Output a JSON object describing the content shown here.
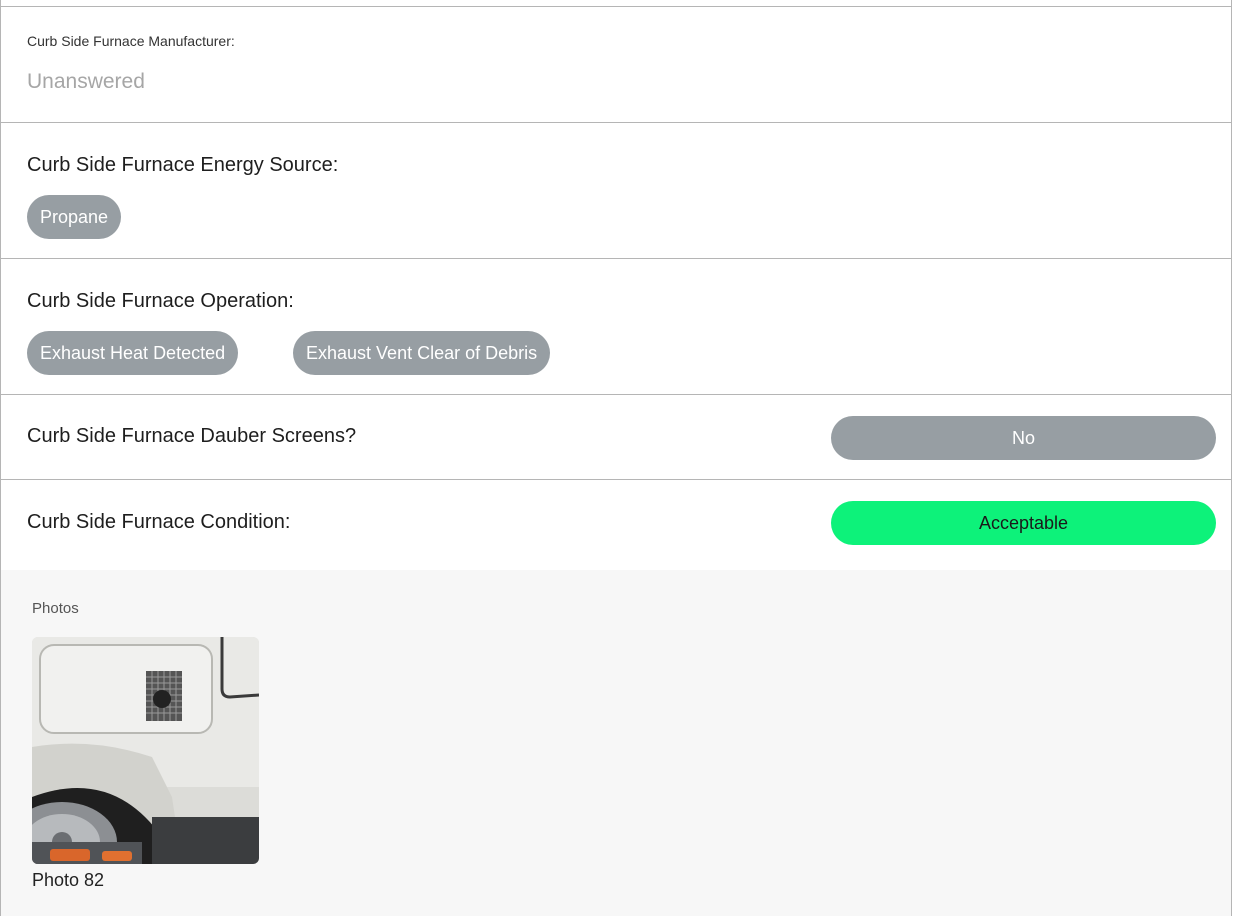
{
  "manufacturer": {
    "label": "Curb Side Furnace Manufacturer:",
    "value": "Unanswered"
  },
  "energy_source": {
    "label": "Curb Side Furnace Energy Source:",
    "options": [
      "Propane"
    ]
  },
  "operation": {
    "label": "Curb Side Furnace Operation:",
    "options": [
      "Exhaust Heat Detected",
      "Exhaust Vent Clear of Debris"
    ]
  },
  "dauber_screens": {
    "label": "Curb Side Furnace Dauber Screens?",
    "value": "No",
    "color": "#979ea3"
  },
  "condition": {
    "label": "Curb Side Furnace Condition:",
    "value": "Acceptable",
    "color": "#0df27a"
  },
  "photos": {
    "title": "Photos",
    "items": [
      {
        "caption": "Photo 82"
      }
    ]
  }
}
